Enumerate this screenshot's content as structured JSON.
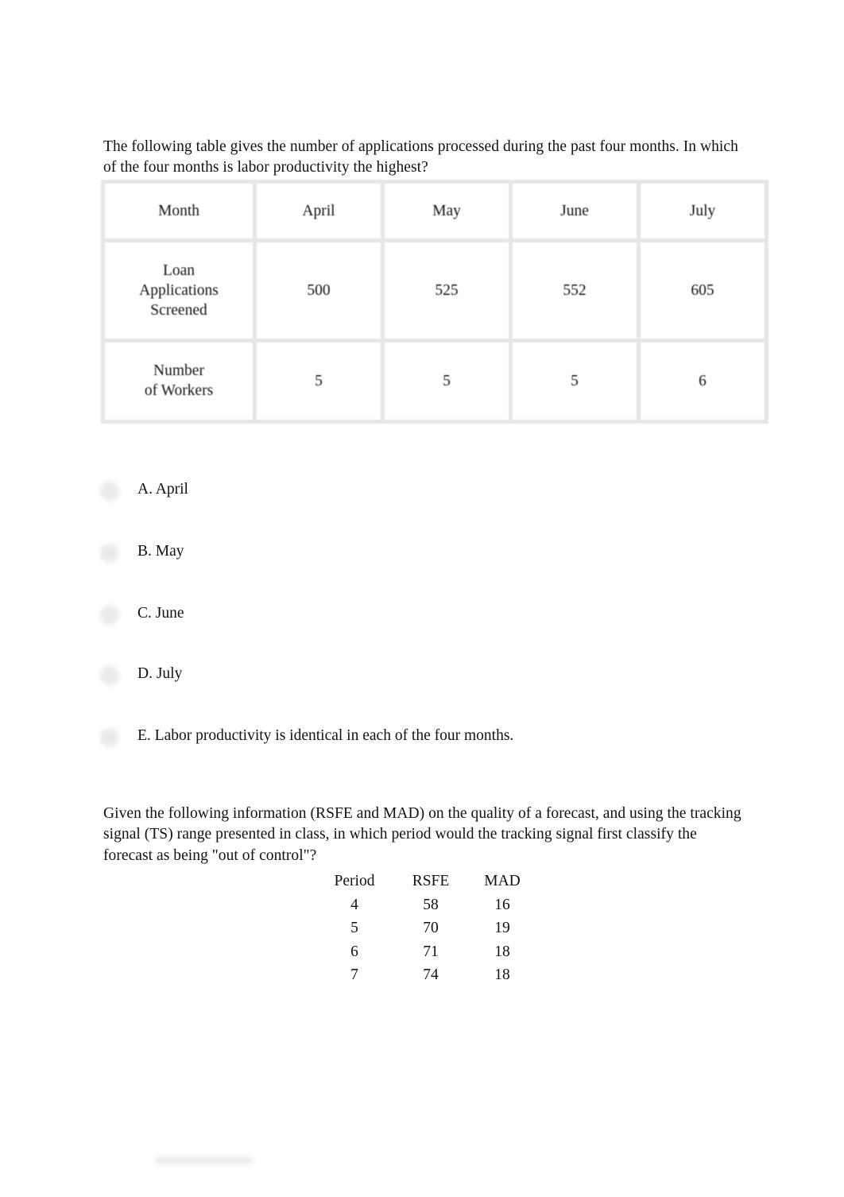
{
  "document": {
    "page_background": "#ffffff",
    "text_color": "#111111"
  },
  "question_1": {
    "prompt": "The following table gives the number of applications processed during the past four months. In which of the four months is labor productivity the highest?",
    "table": {
      "row_labels": [
        "Month",
        "Loan\nApplications\nScreened",
        "Number\nof Workers"
      ],
      "header_label": "Month",
      "months": [
        "April",
        "May",
        "June",
        "July"
      ],
      "rows": [
        {
          "label": "Loan Applications Screened",
          "label_line_1": "Loan",
          "label_line_2": "Applications",
          "label_line_3": "Screened",
          "values": [
            "500",
            "525",
            "552",
            "605"
          ]
        },
        {
          "label": "Number of Workers",
          "label_line_1": "Number",
          "label_line_2": "of Workers",
          "values": [
            "5",
            "5",
            "5",
            "6"
          ]
        }
      ],
      "border_color": "#e6e6e6",
      "cell_background": "#ffffff"
    },
    "options": [
      {
        "id": "A",
        "label": "A. April"
      },
      {
        "id": "B",
        "label": "B. May"
      },
      {
        "id": "C",
        "label": "C. June"
      },
      {
        "id": "D",
        "label": "D. July"
      },
      {
        "id": "E",
        "label": "E. Labor productivity is identical in each of the four months."
      }
    ],
    "radio_color": "#ebebeb"
  },
  "question_2": {
    "prompt": "Given the following information (RSFE and MAD) on the quality of a forecast, and using the tracking signal (TS) range presented in class, in which period would the tracking signal first classify the forecast as being \"out of control\"?",
    "table": {
      "headers": [
        "Period",
        "RSFE",
        "MAD"
      ],
      "rows": [
        [
          "4",
          "58",
          "16"
        ],
        [
          "5",
          "70",
          "19"
        ],
        [
          "6",
          "71",
          "18"
        ],
        [
          "7",
          "74",
          "18"
        ]
      ]
    }
  },
  "chart_data": [
    {
      "type": "table",
      "title": "Applications processed during the past four months",
      "columns": [
        "Month",
        "April",
        "May",
        "June",
        "July"
      ],
      "rows": [
        {
          "label": "Loan Applications Screened",
          "values": [
            500,
            525,
            552,
            605
          ]
        },
        {
          "label": "Number of Workers",
          "values": [
            5,
            5,
            5,
            6
          ]
        }
      ]
    },
    {
      "type": "table",
      "title": "Forecast quality: RSFE and MAD by period",
      "columns": [
        "Period",
        "RSFE",
        "MAD"
      ],
      "rows": [
        {
          "label": "4",
          "values": [
            58,
            16
          ]
        },
        {
          "label": "5",
          "values": [
            70,
            19
          ]
        },
        {
          "label": "6",
          "values": [
            71,
            18
          ]
        },
        {
          "label": "7",
          "values": [
            74,
            18
          ]
        }
      ]
    }
  ]
}
